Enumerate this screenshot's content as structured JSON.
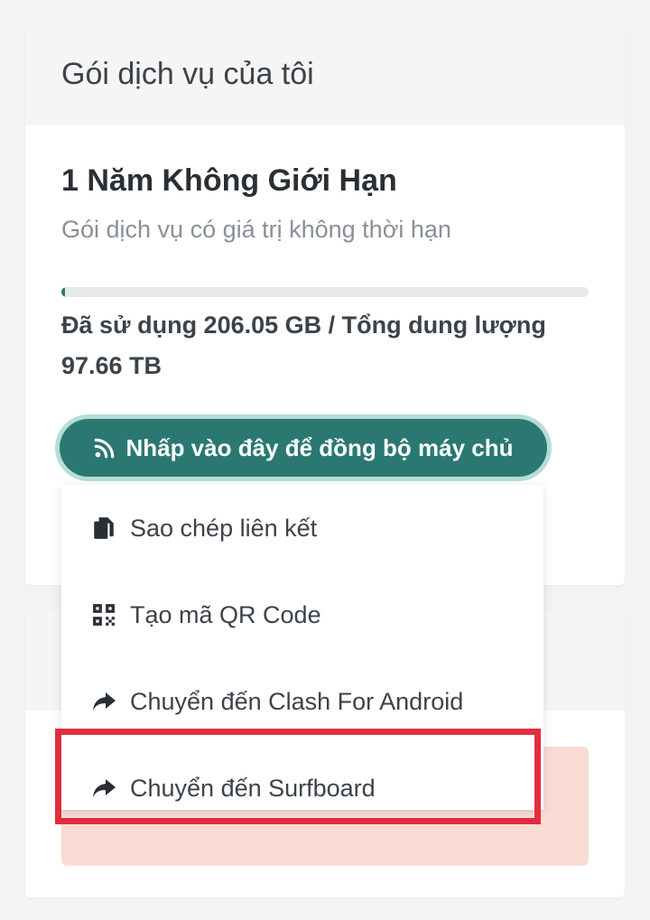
{
  "subscription": {
    "card_title": "Gói dịch vụ của tôi",
    "plan_name": "1 Năm Không Giới Hạn",
    "plan_description": "Gói dịch vụ có giá trị không thời hạn",
    "usage_fraction": 0.002,
    "usage_text": "Đã sử dụng 206.05 GB / Tổng dung lượng 97.66 TB",
    "sync_button_label": "Nhấp vào đây để đồng bộ máy chủ",
    "sync_icon": "rss-icon"
  },
  "dropdown": {
    "items": [
      {
        "label": "Sao chép liên kết",
        "icon": "copy-icon"
      },
      {
        "label": "Tạo mã QR Code",
        "icon": "qrcode-icon"
      },
      {
        "label": "Chuyển đến Clash For Android",
        "icon": "share-icon"
      },
      {
        "label": "Chuyển đến Surfboard",
        "icon": "share-icon"
      }
    ]
  },
  "colors": {
    "primary": "#2a7871",
    "highlight_border": "#e02e40",
    "alert_background": "#f8dcd4",
    "page_background": "#f2f3f4"
  }
}
